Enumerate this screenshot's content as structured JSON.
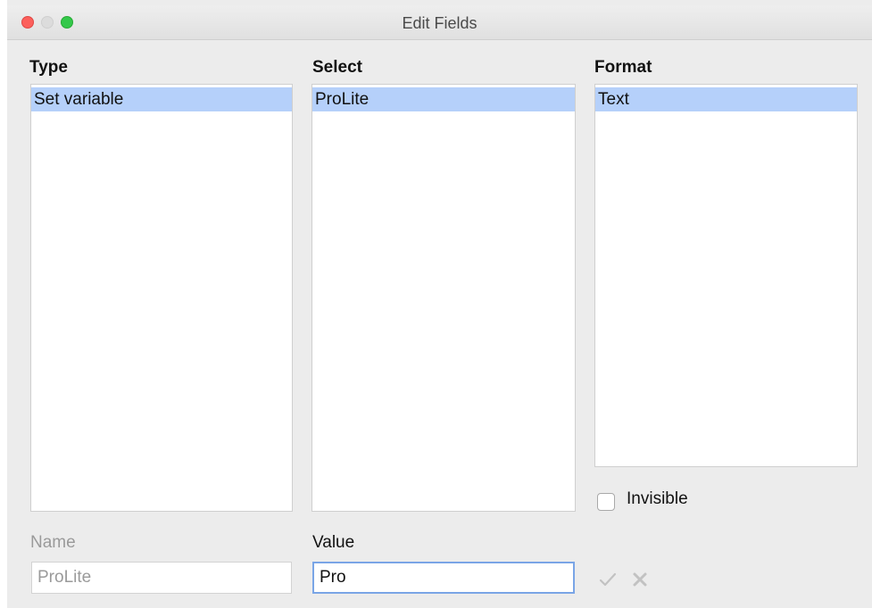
{
  "window": {
    "title": "Edit Fields"
  },
  "type": {
    "header": "Type",
    "items": [
      "Set variable"
    ]
  },
  "select": {
    "header": "Select",
    "items": [
      "ProLite"
    ]
  },
  "format": {
    "header": "Format",
    "items": [
      "Text"
    ]
  },
  "invisible": {
    "label": "Invisible",
    "checked": false
  },
  "name": {
    "label": "Name",
    "value": "ProLite",
    "disabled": true
  },
  "value": {
    "label": "Value",
    "value": "Pro"
  },
  "actions": {
    "apply_icon": "checkmark-icon",
    "remove_icon": "x-mark-icon",
    "enabled": false
  },
  "colors": {
    "selection": "#b5d0fa",
    "focus_border": "#7aa5e6",
    "close": "#fc605c",
    "maximize": "#34c84a"
  }
}
